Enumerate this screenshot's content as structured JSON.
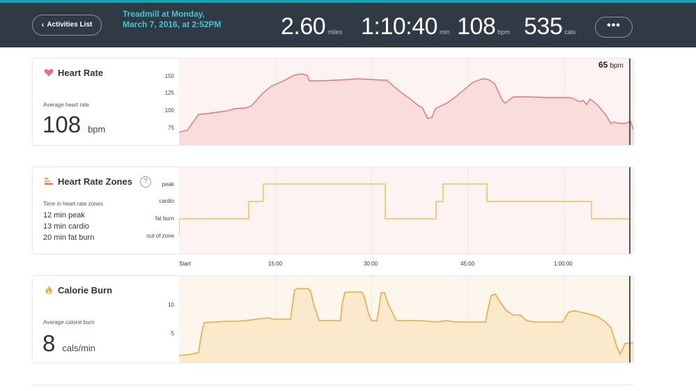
{
  "header": {
    "back_label": "Activities List",
    "activity_title": "Treadmill at Monday, March 7, 2016, at 2:52PM",
    "stats": [
      {
        "value": "2.60",
        "unit": "miles"
      },
      {
        "value": "1:10:40",
        "unit": "min"
      },
      {
        "value": "108",
        "unit": "bpm"
      },
      {
        "value": "535",
        "unit": "cals"
      }
    ],
    "more_label": "•••"
  },
  "heart_rate": {
    "title": "Heart Rate",
    "avg_label": "Average heart rate",
    "avg_value": "108",
    "avg_unit": "bpm",
    "current_value": "65",
    "current_unit": "bpm",
    "yticks": [
      "150",
      "125",
      "100",
      "75"
    ],
    "color": "#e3737a"
  },
  "zones": {
    "title": "Heart Rate Zones",
    "help_label": "?",
    "summary_label": "Time in heart rate zones",
    "lines": [
      "12 min peak",
      "13 min cardio",
      "20 min fat burn"
    ],
    "levels": [
      "peak",
      "cardio",
      "fat burn",
      "out of zone"
    ],
    "color": "#f2c14e"
  },
  "x_axis": [
    "Start",
    "15:00",
    "30:00",
    "45:00",
    "1:00:00"
  ],
  "calories": {
    "title": "Calorie Burn",
    "avg_label": "Average calorie burn",
    "avg_value": "8",
    "avg_unit": "cals/min",
    "yticks": [
      "10",
      "5"
    ],
    "color": "#f0a93a"
  }
}
